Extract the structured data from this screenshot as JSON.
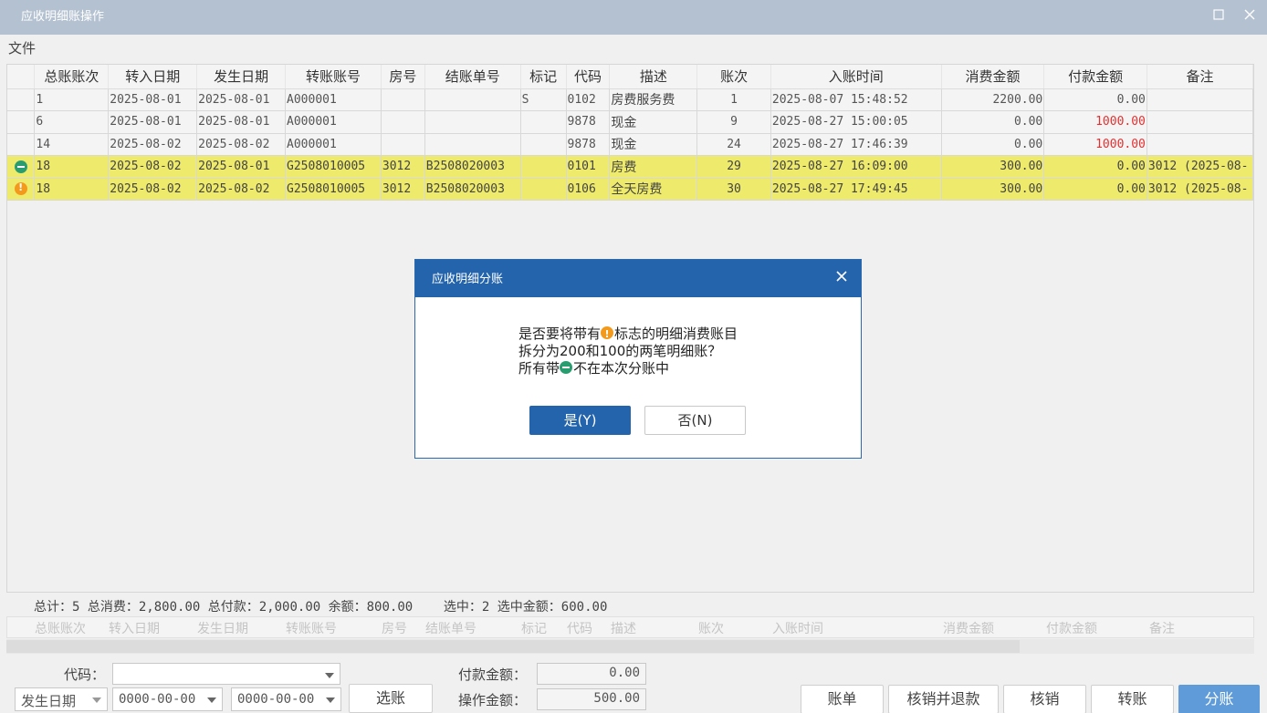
{
  "window": {
    "title": "应收明细账操作",
    "maximize_icon": "maximize-icon",
    "close_icon": "close-icon"
  },
  "menu": {
    "file": "文件"
  },
  "table": {
    "columns": [
      "总账账次",
      "转入日期",
      "发生日期",
      "转账账号",
      "房号",
      "结账单号",
      "标记",
      "代码",
      "描述",
      "账次",
      "入账时间",
      "消费金额",
      "付款金额",
      "备注"
    ],
    "rows": [
      {
        "marker": "",
        "c0": "1",
        "c1": "2025-08-01",
        "c2": "2025-08-01",
        "c3": "A000001",
        "c4": "",
        "c5": "",
        "c6": "S",
        "c7": "0102",
        "c8": "房费服务费",
        "c9": "1",
        "c10": "2025-08-07 15:48:52",
        "c11": "2200.00",
        "c12": "0.00",
        "c13": ""
      },
      {
        "marker": "",
        "c0": "6",
        "c1": "2025-08-01",
        "c2": "2025-08-01",
        "c3": "A000001",
        "c4": "",
        "c5": "",
        "c6": "",
        "c7": "9878",
        "c8": "现金",
        "c9": "9",
        "c10": "2025-08-27 15:00:05",
        "c11": "0.00",
        "c12": "1000.00",
        "c13": ""
      },
      {
        "marker": "",
        "c0": "14",
        "c1": "2025-08-02",
        "c2": "2025-08-02",
        "c3": "A000001",
        "c4": "",
        "c5": "",
        "c6": "",
        "c7": "9878",
        "c8": "现金",
        "c9": "24",
        "c10": "2025-08-27 17:46:39",
        "c11": "0.00",
        "c12": "1000.00",
        "c13": ""
      },
      {
        "marker": "minus",
        "c0": "18",
        "c1": "2025-08-02",
        "c2": "2025-08-01",
        "c3": "G2508010005",
        "c4": "3012",
        "c5": "B2508020003",
        "c6": "",
        "c7": "0101",
        "c8": "房费",
        "c9": "29",
        "c10": "2025-08-27 16:09:00",
        "c11": "300.00",
        "c12": "0.00",
        "c13": "3012 (2025-08-"
      },
      {
        "marker": "warn",
        "c0": "18",
        "c1": "2025-08-02",
        "c2": "2025-08-02",
        "c3": "G2508010005",
        "c4": "3012",
        "c5": "B2508020003",
        "c6": "",
        "c7": "0106",
        "c8": "全天房费",
        "c9": "30",
        "c10": "2025-08-27 17:49:45",
        "c11": "300.00",
        "c12": "0.00",
        "c13": "3012 (2025-08-"
      }
    ]
  },
  "summary": {
    "total": "总计：5",
    "consume": "总消费：2,800.00",
    "paid": "总付款：2,000.00",
    "balance": "余额：800.00",
    "selected": "选中：2",
    "selected_amount": "选中金额：600.00"
  },
  "footer_columns": [
    "总账账次",
    "转入日期",
    "发生日期",
    "转账账号",
    "房号",
    "结账单号",
    "标记",
    "代码",
    "描述",
    "账次",
    "入账时间",
    "消费金额",
    "付款金额",
    "备注"
  ],
  "form": {
    "code_label": "代码：",
    "code_value": "",
    "date_type": "发生日期",
    "date_from": "0000-00-00",
    "date_to": "0000-00-00",
    "select_button": "选账",
    "pay_amount_label": "付款金额：",
    "pay_amount_value": "0.00",
    "op_amount_label": "操作金额：",
    "op_amount_value": "500.00"
  },
  "actions": {
    "bill": "账单",
    "writeoff_refund": "核销并退款",
    "writeoff": "核销",
    "transfer": "转账",
    "split": "分账"
  },
  "dialog": {
    "title": "应收明细分账",
    "line1_pre": "是否要将带有",
    "line1_post": "标志的明细消费账目",
    "line2": "拆分为200和100的两笔明细账？",
    "line3_pre": "所有带",
    "line3_post": "不在本次分账中",
    "yes": "是(Y)",
    "no": "否(N)"
  },
  "colors": {
    "title_bar": "#b4c1d1",
    "highlight_row": "#eeea6c",
    "dialog_header": "#2464ac",
    "pay_red": "#e53030",
    "primary_button": "#5e9bd8"
  }
}
